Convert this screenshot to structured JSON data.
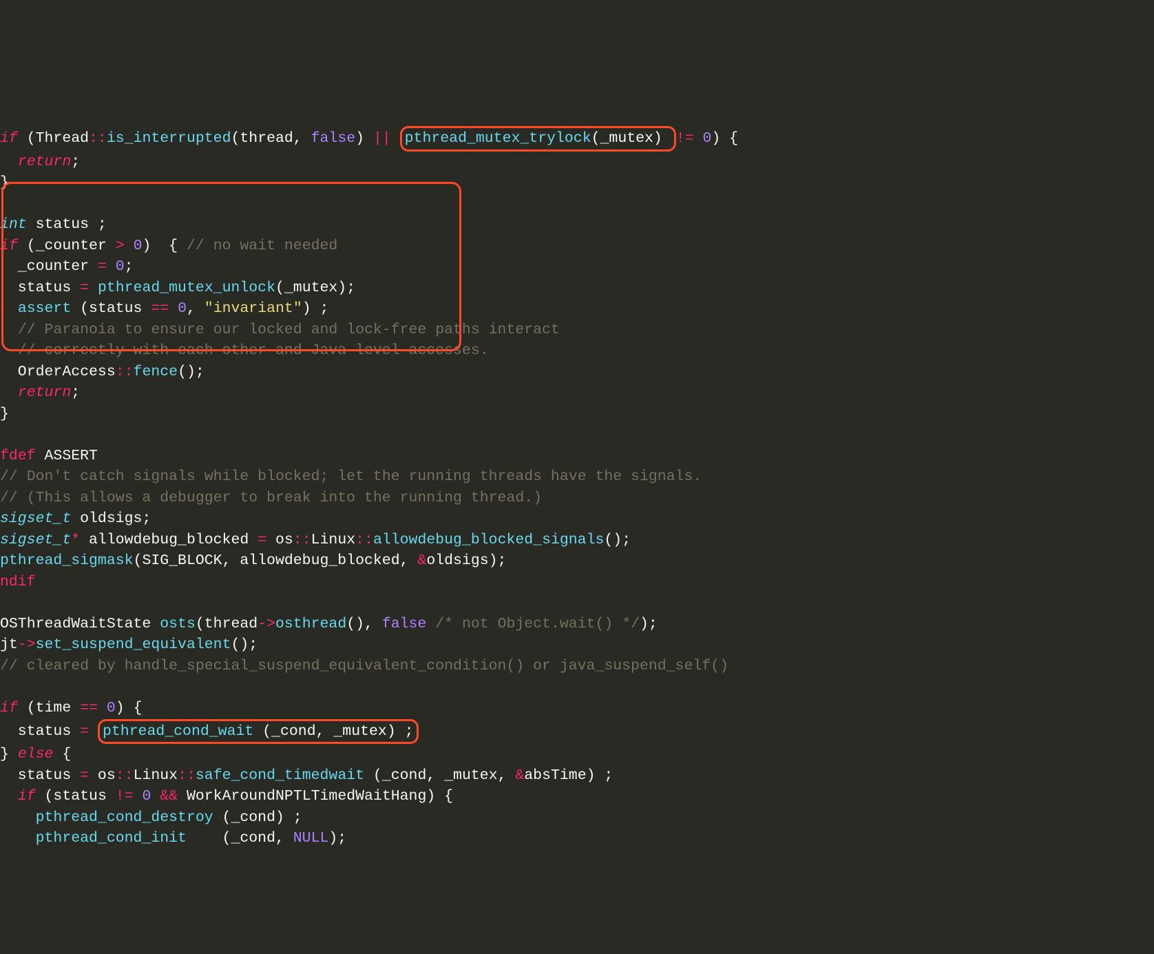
{
  "code": {
    "l1a": "if",
    "l1b": " (Thread",
    "l1c": "::",
    "l1d": "is_interrupted",
    "l1e": "(thread, ",
    "l1f": "false",
    "l1g": ") ",
    "l1h": "||",
    "l1i": " ",
    "l1j": "pthread_mutex_trylock",
    "l1k": "(_mutex) ",
    "l1l": "!=",
    "l1m": " ",
    "l1n": "0",
    "l1o": ") {",
    "l2a": "  ",
    "l2b": "return",
    "l2c": ";",
    "l3a": "}",
    "l5a": "int",
    "l5b": " status ;",
    "l6a": "if",
    "l6b": " (_counter ",
    "l6c": ">",
    "l6d": " ",
    "l6e": "0",
    "l6f": ")  { ",
    "l6g": "// no wait needed",
    "l7a": "  _counter ",
    "l7b": "=",
    "l7c": " ",
    "l7d": "0",
    "l7e": ";",
    "l8a": "  status ",
    "l8b": "=",
    "l8c": " ",
    "l8d": "pthread_mutex_unlock",
    "l8e": "(_mutex);",
    "l9a": "  ",
    "l9b": "assert",
    "l9c": " (status ",
    "l9d": "==",
    "l9e": " ",
    "l9f": "0",
    "l9g": ", ",
    "l9h": "\"invariant\"",
    "l9i": ") ;",
    "l10a": "  ",
    "l10b": "// Paranoia to ensure our locked and lock-free paths interact",
    "l11a": "  ",
    "l11b": "// correctly with each other and Java-level accesses.",
    "l12a": "  OrderAccess",
    "l12b": "::",
    "l12c": "fence",
    "l12d": "();",
    "l13a": "  ",
    "l13b": "return",
    "l13c": ";",
    "l14a": "}",
    "l16a": "fdef",
    "l16b": " ASSERT",
    "l17a": "// Don't catch signals while blocked; let the running threads have the signals.",
    "l18a": "// (This allows a debugger to break into the running thread.)",
    "l19a": "sigset_t",
    "l19b": " oldsigs;",
    "l20a": "sigset_t",
    "l20b": "*",
    "l20c": " allowdebug_blocked ",
    "l20d": "=",
    "l20e": " os",
    "l20f": "::",
    "l20g": "Linux",
    "l20h": "::",
    "l20i": "allowdebug_blocked_signals",
    "l20j": "();",
    "l21a": "pthread_sigmask",
    "l21b": "(SIG_BLOCK, allowdebug_blocked, ",
    "l21c": "&",
    "l21d": "oldsigs);",
    "l22a": "ndif",
    "l24a": "OSThreadWaitState ",
    "l24b": "osts",
    "l24c": "(thread",
    "l24d": "->",
    "l24e": "osthread",
    "l24f": "(), ",
    "l24g": "false",
    "l24h": " ",
    "l24i": "/* not Object.wait() */",
    "l24j": ");",
    "l25a": "jt",
    "l25b": "->",
    "l25c": "set_suspend_equivalent",
    "l25d": "();",
    "l26a": "// cleared by handle_special_suspend_equivalent_condition() or java_suspend_self()",
    "l28a": "if",
    "l28b": " (time ",
    "l28c": "==",
    "l28d": " ",
    "l28e": "0",
    "l28f": ") {",
    "l29a": "  status ",
    "l29b": "=",
    "l29c": " ",
    "l29d": "pthread_cond_wait",
    "l29e": " (_cond, _mutex) ;",
    "l30a": "} ",
    "l30b": "else",
    "l30c": " {",
    "l31a": "  status ",
    "l31b": "=",
    "l31c": " os",
    "l31d": "::",
    "l31e": "Linux",
    "l31f": "::",
    "l31g": "safe_cond_timedwait",
    "l31h": " (_cond, _mutex, ",
    "l31i": "&",
    "l31j": "absTime) ;",
    "l32a": "  ",
    "l32b": "if",
    "l32c": " (status ",
    "l32d": "!=",
    "l32e": " ",
    "l32f": "0",
    "l32g": " ",
    "l32h": "&&",
    "l32i": " WorkAroundNPTLTimedWaitHang) {",
    "l33a": "    ",
    "l33b": "pthread_cond_destroy",
    "l33c": " (_cond) ;",
    "l34a": "    ",
    "l34b": "pthread_cond_init",
    "l34c": "    (_cond, ",
    "l34d": "NULL",
    "l34e": ");"
  }
}
